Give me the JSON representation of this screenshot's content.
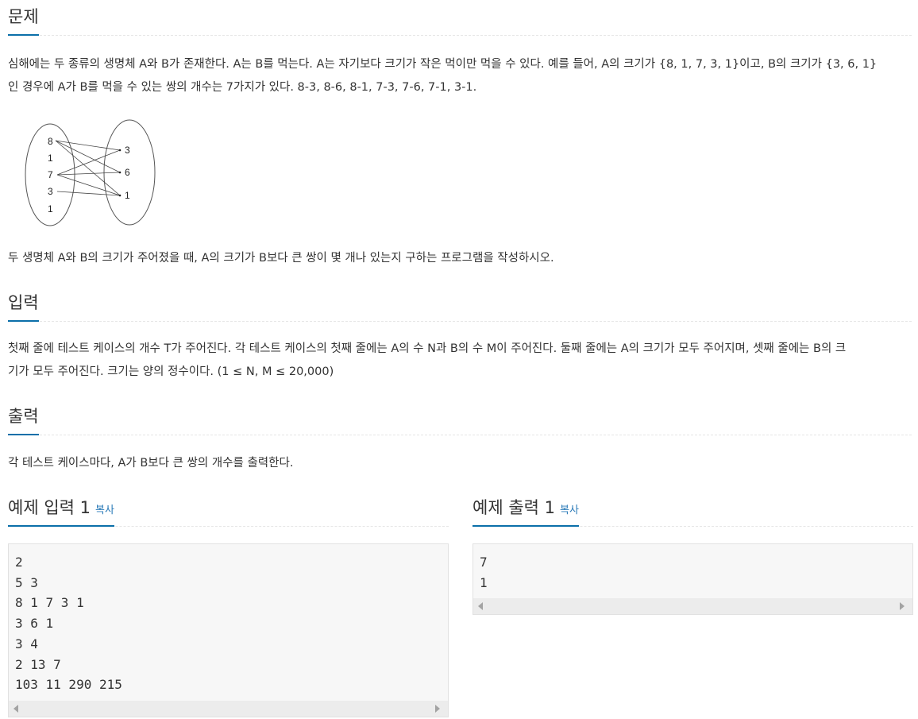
{
  "problem": {
    "heading": "문제",
    "line1": "심해에는 두 종류의 생명체 A와 B가 존재한다. A는 B를 먹는다. A는 자기보다 크기가 작은 먹이만 먹을 수 있다. 예를 들어, A의 크기가 {8, 1, 7, 3, 1}이고, B의 크기가 {3, 6, 1}",
    "line2": "인 경우에 A가 B를 먹을 수 있는 쌍의 개수는 7가지가 있다. 8-3, 8-6, 8-1, 7-3, 7-6, 7-1, 3-1.",
    "question": "두 생명체 A와 B의 크기가 주어졌을 때, A의 크기가 B보다 큰 쌍이 몇 개나 있는지 구하는 프로그램을 작성하시오."
  },
  "diagram": {
    "a_values": [
      "8",
      "1",
      "7",
      "3",
      "1"
    ],
    "b_values": [
      "3",
      "6",
      "1"
    ]
  },
  "input": {
    "heading": "입력",
    "line1": "첫째 줄에 테스트 케이스의 개수 T가 주어진다. 각 테스트 케이스의 첫째 줄에는 A의 수 N과 B의 수 M이 주어진다. 둘째 줄에는 A의 크기가 모두 주어지며, 셋째 줄에는 B의 크",
    "line2": "기가 모두 주어진다. 크기는 양의 정수이다. (1 ≤ N, M ≤ 20,000)"
  },
  "output": {
    "heading": "출력",
    "text": "각 테스트 케이스마다, A가 B보다 큰 쌍의 개수를 출력한다."
  },
  "sample_input": {
    "heading": "예제 입력 1",
    "copy_label": "복사",
    "lines": [
      "2",
      "5 3",
      "8 1 7 3 1",
      "3 6 1",
      "3 4",
      "2 13 7",
      "103 11 290 215"
    ]
  },
  "sample_output": {
    "heading": "예제 출력 1",
    "copy_label": "복사",
    "lines": [
      "7",
      "1"
    ]
  }
}
